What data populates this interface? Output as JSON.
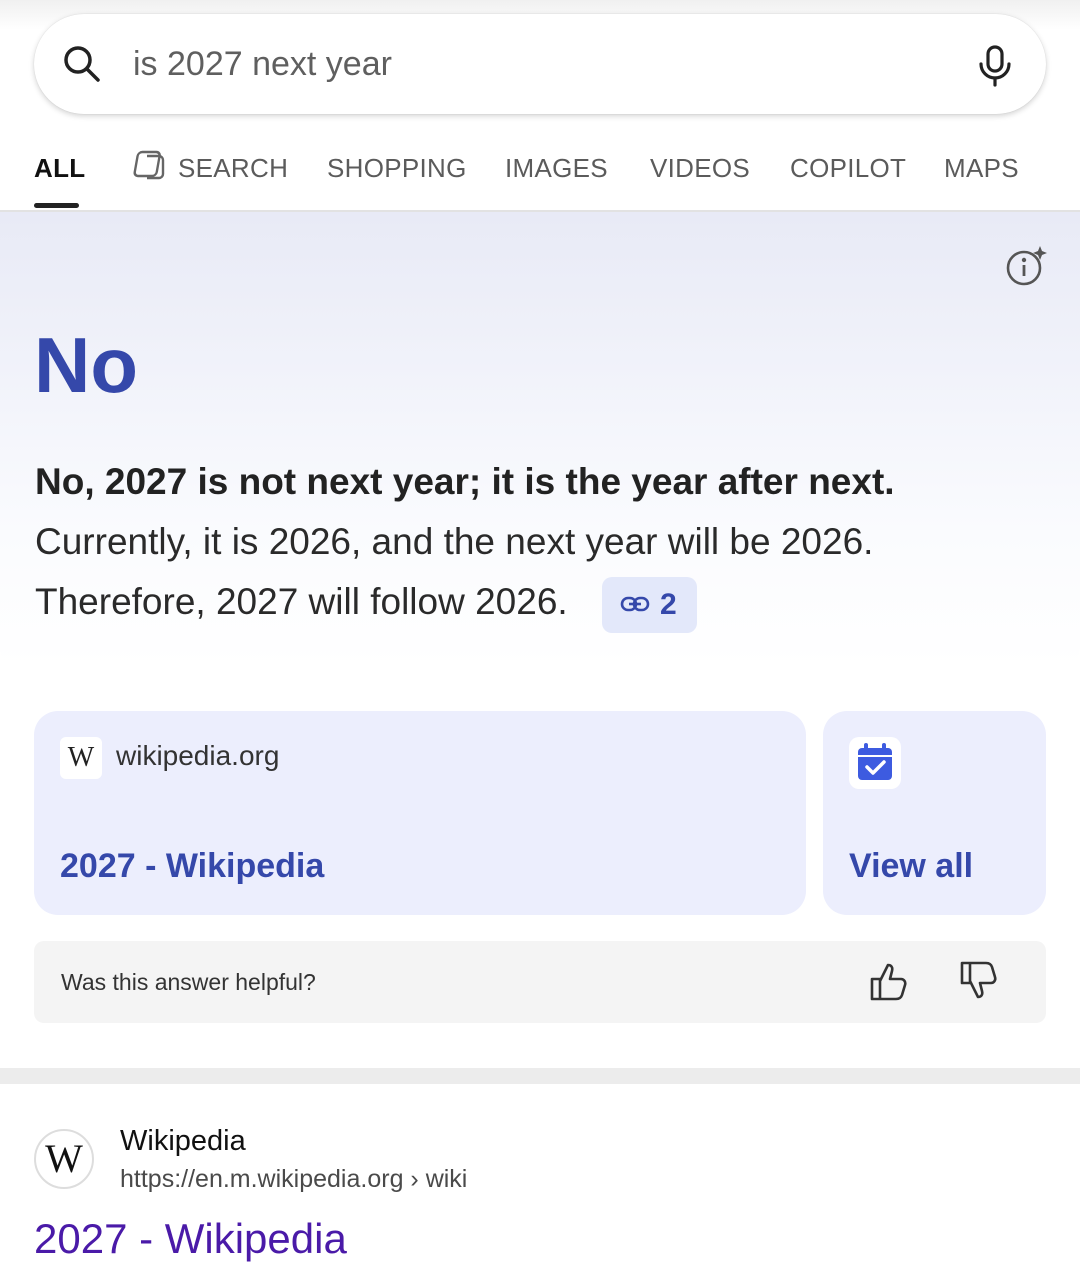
{
  "search": {
    "query": "is 2027 next year"
  },
  "tabs": [
    {
      "label": "ALL",
      "active": true
    },
    {
      "label": "SEARCH",
      "icon": "copilot-search-icon"
    },
    {
      "label": "SHOPPING"
    },
    {
      "label": "IMAGES"
    },
    {
      "label": "VIDEOS"
    },
    {
      "label": "COPILOT"
    },
    {
      "label": "MAPS"
    }
  ],
  "answer": {
    "headline": "No",
    "bold_sentence": "No, 2027 is not next year; it is the year after next.",
    "line1": "Currently, it is 2026, and the next year will be 2026.",
    "line2": "Therefore, 2027 will follow 2026.",
    "citation_count": "2",
    "accent_color": "#3548aa"
  },
  "sources": {
    "primary": {
      "domain": "wikipedia.org",
      "title": "2027 - Wikipedia",
      "logo": "W"
    },
    "view_all": {
      "label": "View all",
      "icon": "calendar-check-icon"
    }
  },
  "feedback": {
    "question": "Was this answer helpful?"
  },
  "result": {
    "site_name": "Wikipedia",
    "url": "https://en.m.wikipedia.org › wiki",
    "title": "2027 - Wikipedia",
    "logo": "W",
    "title_color": "#4a1aa8"
  }
}
